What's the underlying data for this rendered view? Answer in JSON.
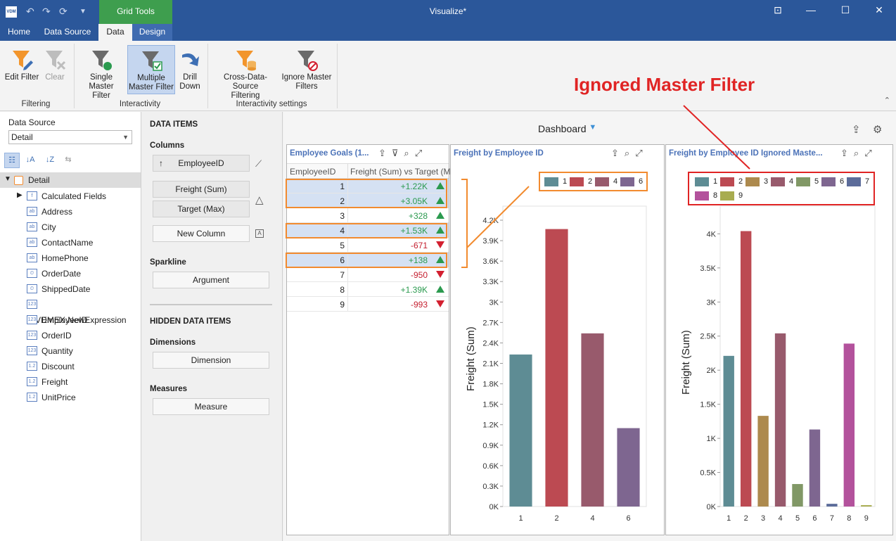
{
  "window": {
    "title": "Visualize*",
    "logo": "VDM",
    "context_tab": "Grid Tools"
  },
  "tabs": [
    "Home",
    "Data Source",
    "Data",
    "Design"
  ],
  "ribbon": {
    "buttons": {
      "edit_filter": "Edit Filter",
      "clear": "Clear",
      "single_master_1": "Single Master",
      "single_master_2": "Filter",
      "multiple_master_1": "Multiple",
      "multiple_master_2": "Master Filter",
      "drill_1": "Drill",
      "drill_2": "Down",
      "cross_1": "Cross-Data-Source",
      "cross_2": "Filtering",
      "ignore_1": "Ignore Master",
      "ignore_2": "Filters"
    },
    "groups": {
      "filtering": "Filtering",
      "interactivity": "Interactivity",
      "interactivity_settings": "Interactivity settings"
    }
  },
  "left_panel": {
    "label": "Data Source",
    "select_value": "Detail",
    "root": "Detail",
    "fields": [
      {
        "icon": "f",
        "label": "Calculated Fields"
      },
      {
        "icon": "ab",
        "label": "Address"
      },
      {
        "icon": "ab",
        "label": "City"
      },
      {
        "icon": "ab",
        "label": "ContactName"
      },
      {
        "icon": "ab",
        "label": "HomePhone"
      },
      {
        "icon": "⏲",
        "label": "OrderDate"
      },
      {
        "icon": "⏲",
        "label": "ShippedDate"
      },
      {
        "icon": "123",
        "label": "@VDMEX.NewExpression"
      },
      {
        "icon": "123",
        "label": "EmployeeID"
      },
      {
        "icon": "123",
        "label": "OrderID"
      },
      {
        "icon": "123",
        "label": "Quantity"
      },
      {
        "icon": "1.2",
        "label": "Discount"
      },
      {
        "icon": "1.2",
        "label": "Freight"
      },
      {
        "icon": "1.2",
        "label": "UnitPrice"
      }
    ]
  },
  "data_items": {
    "title": "DATA ITEMS",
    "columns_label": "Columns",
    "employee_id": "EmployeeID",
    "freight": "Freight (Sum)",
    "target": "Target (Max)",
    "new_column": "New Column",
    "sparkline_label": "Sparkline",
    "argument": "Argument",
    "hidden_title": "HIDDEN DATA ITEMS",
    "dimensions_label": "Dimensions",
    "dimension": "Dimension",
    "measures_label": "Measures",
    "measure": "Measure"
  },
  "dashboard": {
    "title": "Dashboard",
    "callout": "Ignored Master Filter",
    "grid": {
      "title": "Employee Goals (1...",
      "col_id": "EmployeeID",
      "col_value": "Freight (Sum) vs Target (M...",
      "rows": [
        {
          "id": "1",
          "value": "+1.22K",
          "trend": "up",
          "selected": true
        },
        {
          "id": "2",
          "value": "+3.05K",
          "trend": "up",
          "selected": true
        },
        {
          "id": "3",
          "value": "+328",
          "trend": "up",
          "selected": false
        },
        {
          "id": "4",
          "value": "+1.53K",
          "trend": "up",
          "selected": true
        },
        {
          "id": "5",
          "value": "-671",
          "trend": "down",
          "selected": false
        },
        {
          "id": "6",
          "value": "+138",
          "trend": "up",
          "selected": true
        },
        {
          "id": "7",
          "value": "-950",
          "trend": "down",
          "selected": false
        },
        {
          "id": "8",
          "value": "+1.39K",
          "trend": "up",
          "selected": false
        },
        {
          "id": "9",
          "value": "-993",
          "trend": "down",
          "selected": false
        }
      ]
    }
  },
  "chart_data": [
    {
      "type": "bar",
      "title": "Freight by Employee ID",
      "ylabel": "Freight (Sum)",
      "categories": [
        "1",
        "2",
        "4",
        "6"
      ],
      "values": [
        2230,
        4070,
        2540,
        1150
      ],
      "colors": [
        "#5e8c94",
        "#bc4a52",
        "#985a6c",
        "#7e6690"
      ],
      "ylim": [
        0,
        4200
      ],
      "yticks": [
        0,
        300,
        600,
        900,
        1200,
        1500,
        1800,
        2100,
        2400,
        2700,
        3000,
        3300,
        3600,
        3900,
        4200
      ],
      "ytick_labels": [
        "0K",
        "0.3K",
        "0.6K",
        "0.9K",
        "1.2K",
        "1.5K",
        "1.8K",
        "2.1K",
        "2.4K",
        "2.7K",
        "3K",
        "3.3K",
        "3.6K",
        "3.9K",
        "4.2K"
      ]
    },
    {
      "type": "bar",
      "title": "Freight by Employee ID Ignored Maste...",
      "ylabel": "Freight (Sum)",
      "categories": [
        "1",
        "2",
        "3",
        "4",
        "5",
        "6",
        "7",
        "8",
        "9"
      ],
      "values": [
        2210,
        4040,
        1330,
        2540,
        330,
        1130,
        40,
        2390,
        20
      ],
      "colors": [
        "#5e8c94",
        "#bc4a52",
        "#ad8a4e",
        "#985a6c",
        "#819866",
        "#7e6690",
        "#5c6c9a",
        "#b3529c",
        "#a8ac50"
      ],
      "ylim": [
        0,
        4200
      ],
      "yticks": [
        0,
        500,
        1000,
        1500,
        2000,
        2500,
        3000,
        3500,
        4000
      ],
      "ytick_labels": [
        "0K",
        "0.5K",
        "1K",
        "1.5K",
        "2K",
        "2.5K",
        "3K",
        "3.5K",
        "4K"
      ]
    }
  ]
}
